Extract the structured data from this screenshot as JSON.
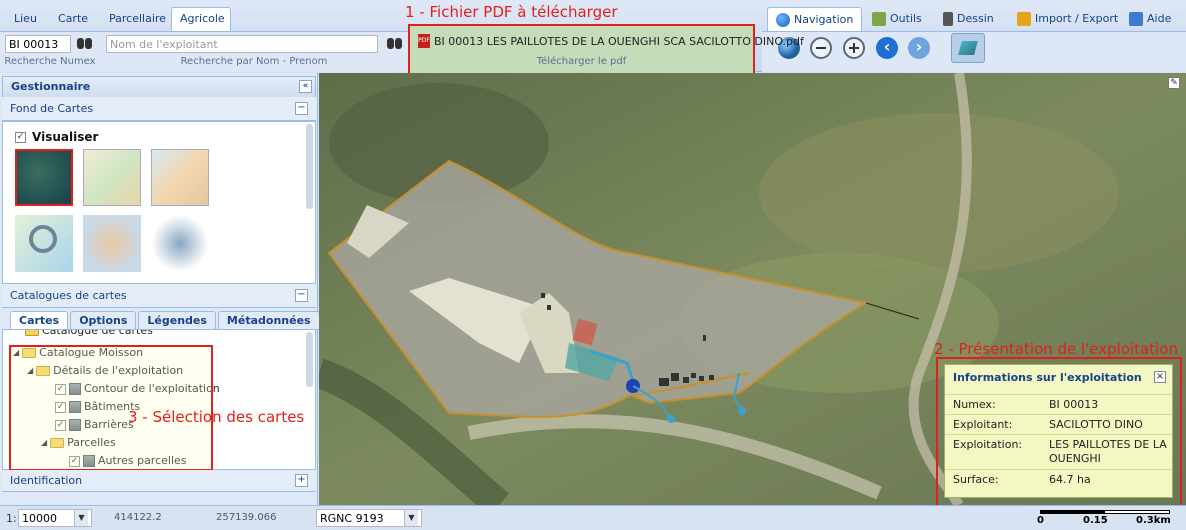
{
  "top_tabs_left": [
    "Lieu",
    "Carte",
    "Parcellaire",
    "Agricole"
  ],
  "top_tabs_right": [
    "Navigation",
    "Outils",
    "Dessin",
    "Import / Export",
    "Aide"
  ],
  "search": {
    "numex_value": "BI 00013",
    "numex_label": "Recherche Numex",
    "name_placeholder": "Nom de l'exploitant",
    "name_label": "Recherche par Nom - Prenom"
  },
  "pdf": {
    "annotation": "1 - Fichier PDF à télécharger",
    "filename": "BI 00013 LES PAILLOTES DE LA OUENGHI SCA SACILOTTO DINO.pdf",
    "download_label": "Télécharger le pdf"
  },
  "panel": {
    "title": "Gestionnaire",
    "fond_de_cartes": "Fond de Cartes",
    "visualiser": "Visualiser",
    "catalogues": "Catalogues de cartes",
    "tabs": [
      "Cartes",
      "Options",
      "Légendes",
      "Métadonnées"
    ],
    "identification": "Identification"
  },
  "tree": {
    "items": [
      "Catalogue de cartes",
      "Catalogue Moisson",
      "Détails de l'exploitation",
      "Contour de l'exploitation",
      "Bâtiments",
      "Barrières",
      "Parcelles",
      "Autres parcelles"
    ],
    "annotation": "3 - Sélection des cartes"
  },
  "info": {
    "annotation": "2 - Présentation de l'exploitation",
    "title": "Informations sur l'exploitation",
    "rows": [
      {
        "key": "Numex:",
        "value": "BI 00013"
      },
      {
        "key": "Exploitant:",
        "value": "SACILOTTO DINO"
      },
      {
        "key": "Exploitation:",
        "value": "LES PAILLOTES DE LA OUENGHI"
      },
      {
        "key": "Surface:",
        "value": "64.7 ha"
      }
    ]
  },
  "status": {
    "scale_prefix": "1:",
    "scale_value": "10000",
    "coord_x": "414122.2",
    "coord_y": "257139.066",
    "projection": "RGNC 9193",
    "scalebar_0": "0",
    "scalebar_mid": "0.15",
    "scalebar_max": "0.3km"
  },
  "colors": {
    "annotation_red": "#e0201b",
    "popup_bg": "#f5f7c2",
    "panel_blue": "#15428b"
  }
}
